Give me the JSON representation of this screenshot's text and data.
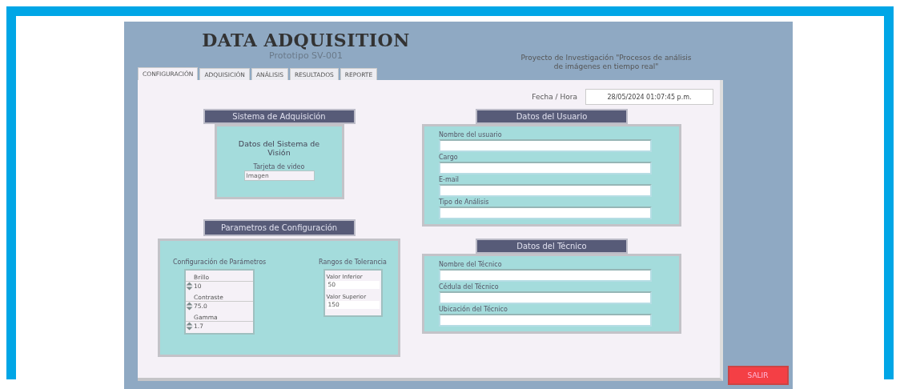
{
  "header": {
    "title": "DATA ADQUISITION",
    "subtitle": "Prototipo SV-001",
    "project_note": [
      "Proyecto de Investigación \"Procesos de análisis",
      "de imágenes en tiempo real\""
    ]
  },
  "tabs": [
    {
      "label": "CONFIGURACIÓN",
      "selected": true
    },
    {
      "label": "ADQUISICIÓN",
      "selected": false
    },
    {
      "label": "ANÁLISIS",
      "selected": false
    },
    {
      "label": "RESULTADOS",
      "selected": false
    },
    {
      "label": "REPORTE",
      "selected": false
    }
  ],
  "datetime": {
    "label": "Fecha / Hora",
    "value": "28/05/2024 01:07:45 p.m."
  },
  "acquisition": {
    "heading": "Sistema de Adquisición",
    "title": "Datos del Sistema de Visión",
    "field_label": "Tarjeta de video",
    "field_value": "Imagen"
  },
  "parameters": {
    "heading": "Parametros de Configuración",
    "group_label": "Configuración de Parámetros",
    "controls": [
      {
        "label": "Brillo",
        "value": "10"
      },
      {
        "label": "Contraste",
        "value": "75.0"
      },
      {
        "label": "Gamma",
        "value": "1.7"
      }
    ],
    "tolerance_label": "Rangos de Tolerancia",
    "tolerance": [
      {
        "label": "Valor Inferior",
        "value": "50"
      },
      {
        "label": "Valor Superior",
        "value": "150"
      }
    ]
  },
  "user": {
    "heading": "Datos del Usuario",
    "fields": [
      {
        "label": "Nombre del usuario"
      },
      {
        "label": "Cargo"
      },
      {
        "label": "E-mail"
      },
      {
        "label": "Tipo de Análisis"
      }
    ]
  },
  "technician": {
    "heading": "Datos del Técnico",
    "fields": [
      {
        "label": "Nombre del Técnico"
      },
      {
        "label": "Cédula del Técnico"
      },
      {
        "label": "Ubicación del Técnico"
      }
    ]
  },
  "exit_button": "SALIR"
}
